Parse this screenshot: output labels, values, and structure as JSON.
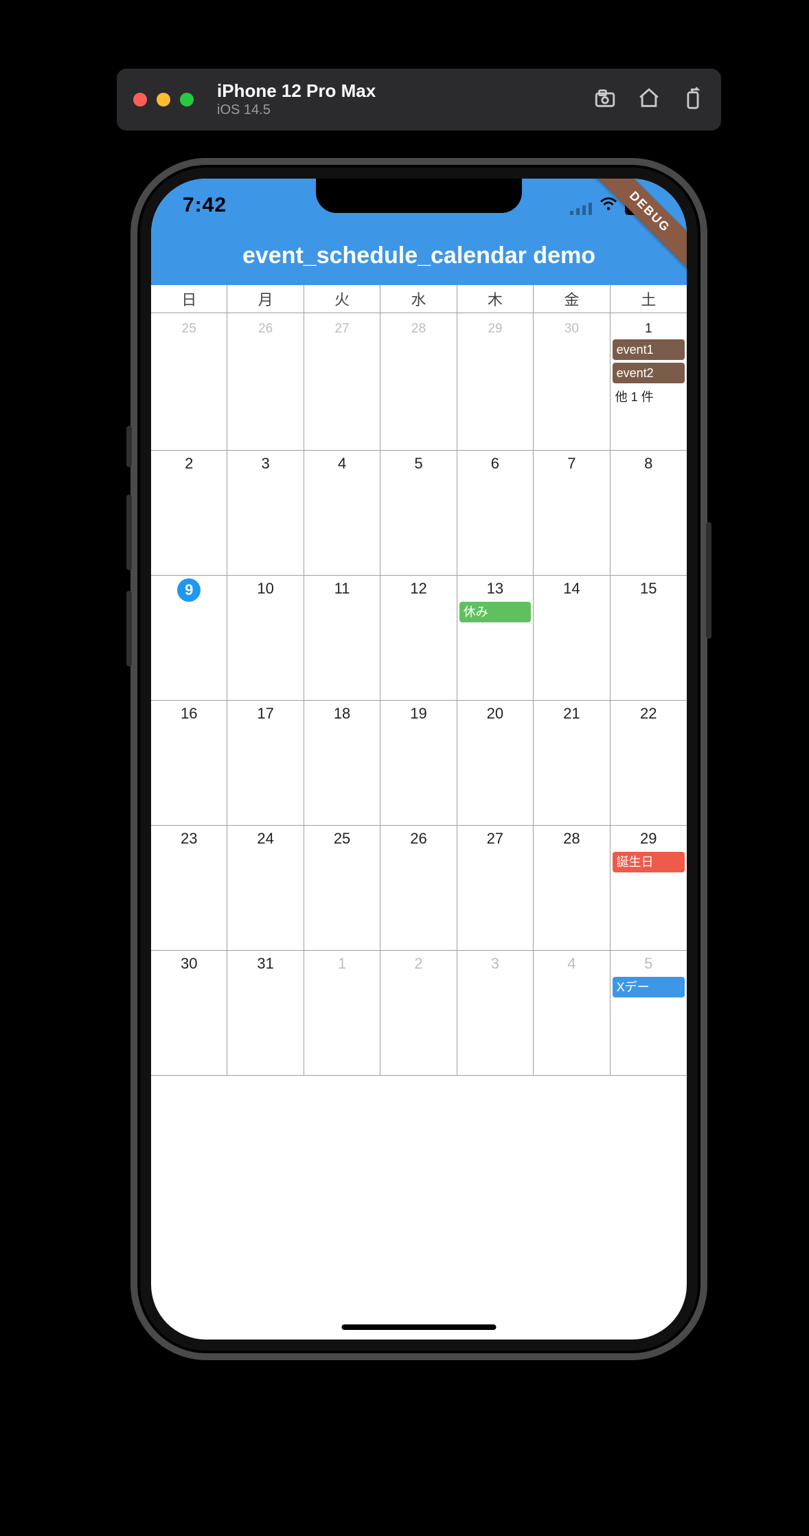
{
  "simulator": {
    "device_name": "iPhone 12 Pro Max",
    "os_version": "iOS 14.5"
  },
  "status": {
    "time": "7:42"
  },
  "debug_banner": "DEBUG",
  "app": {
    "title": "event_schedule_calendar demo"
  },
  "calendar": {
    "day_of_week": [
      "日",
      "月",
      "火",
      "水",
      "木",
      "金",
      "土"
    ],
    "weeks": [
      [
        {
          "day": "25",
          "dim": true
        },
        {
          "day": "26",
          "dim": true
        },
        {
          "day": "27",
          "dim": true
        },
        {
          "day": "28",
          "dim": true
        },
        {
          "day": "29",
          "dim": true
        },
        {
          "day": "30",
          "dim": true
        },
        {
          "day": "1",
          "events": [
            {
              "label": "event1",
              "color": "brown"
            },
            {
              "label": "event2",
              "color": "brown"
            }
          ],
          "more": "他 1 件"
        }
      ],
      [
        {
          "day": "2"
        },
        {
          "day": "3"
        },
        {
          "day": "4"
        },
        {
          "day": "5"
        },
        {
          "day": "6"
        },
        {
          "day": "7"
        },
        {
          "day": "8"
        }
      ],
      [
        {
          "day": "9",
          "today": true
        },
        {
          "day": "10"
        },
        {
          "day": "11"
        },
        {
          "day": "12"
        },
        {
          "day": "13",
          "events": [
            {
              "label": "休み",
              "color": "green"
            }
          ]
        },
        {
          "day": "14"
        },
        {
          "day": "15"
        }
      ],
      [
        {
          "day": "16"
        },
        {
          "day": "17"
        },
        {
          "day": "18"
        },
        {
          "day": "19"
        },
        {
          "day": "20"
        },
        {
          "day": "21"
        },
        {
          "day": "22"
        }
      ],
      [
        {
          "day": "23"
        },
        {
          "day": "24"
        },
        {
          "day": "25"
        },
        {
          "day": "26"
        },
        {
          "day": "27"
        },
        {
          "day": "28"
        },
        {
          "day": "29",
          "events": [
            {
              "label": "誕生日",
              "color": "red"
            }
          ]
        }
      ],
      [
        {
          "day": "30"
        },
        {
          "day": "31"
        },
        {
          "day": "1",
          "dim": true
        },
        {
          "day": "2",
          "dim": true
        },
        {
          "day": "3",
          "dim": true
        },
        {
          "day": "4",
          "dim": true
        },
        {
          "day": "5",
          "dim": true,
          "events": [
            {
              "label": "Xデー",
              "color": "blue"
            }
          ]
        }
      ]
    ]
  }
}
